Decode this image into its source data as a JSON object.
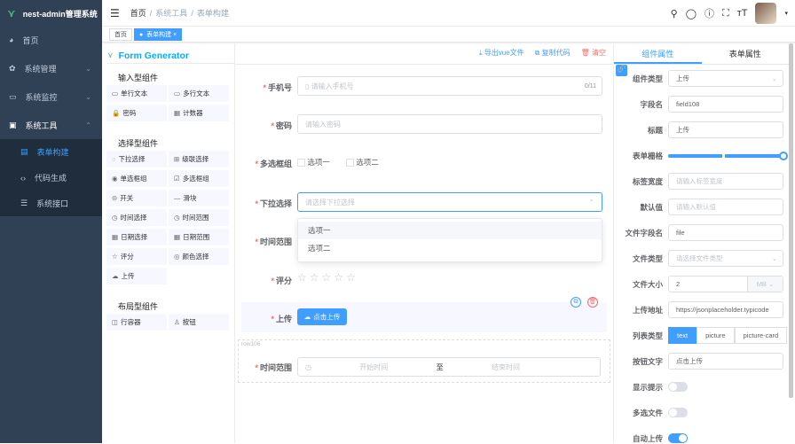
{
  "app": {
    "title": "nest-admin管理系统"
  },
  "sidebar": {
    "items": [
      {
        "label": "首页"
      },
      {
        "label": "系统管理"
      },
      {
        "label": "系统监控"
      },
      {
        "label": "系统工具"
      }
    ],
    "sub": [
      {
        "label": "表单构建"
      },
      {
        "label": "代码生成"
      },
      {
        "label": "系统接口"
      }
    ]
  },
  "breadcrumb": [
    "首页",
    "系统工具",
    "表单构建"
  ],
  "tags": [
    {
      "label": "首页"
    },
    {
      "label": "表单构建"
    }
  ],
  "generator": {
    "title": "Form Generator",
    "export": "导出vue文件",
    "copy": "复制代码",
    "clear": "清空"
  },
  "palette": {
    "cats": [
      {
        "title": "输入型组件",
        "items": [
          "单行文本",
          "多行文本",
          "密码",
          "计数器"
        ]
      },
      {
        "title": "选择型组件",
        "items": [
          "下拉选择",
          "级联选择",
          "单选框组",
          "多选框组",
          "开关",
          "滑块",
          "时间选择",
          "时间范围",
          "日期选择",
          "日期范围",
          "评分",
          "颜色选择",
          "上传"
        ]
      },
      {
        "title": "布局型组件",
        "items": [
          "行容器",
          "按钮"
        ]
      }
    ]
  },
  "form": {
    "phone": {
      "label": "手机号",
      "placeholder": "请输入手机号",
      "count": "0/11"
    },
    "password": {
      "label": "密码",
      "placeholder": "请输入密码"
    },
    "checkbox": {
      "label": "多选框组",
      "options": [
        "选项一",
        "选项二"
      ]
    },
    "select": {
      "label": "下拉选择",
      "placeholder": "请选择下拉选择",
      "options": [
        "选项一",
        "选项二"
      ]
    },
    "timerange": {
      "label": "时间范围"
    },
    "rate": {
      "label": "评分",
      "max": 5,
      "value": 0
    },
    "upload": {
      "label": "上传",
      "button": "点击上传"
    },
    "row": {
      "name": "row106",
      "label": "时间范围",
      "start": "开始时间",
      "sep": "至",
      "end": "结束时间"
    }
  },
  "props": {
    "tabs": [
      "组件属性",
      "表单属性"
    ],
    "type": {
      "label": "组件类型",
      "value": "上传"
    },
    "field": {
      "label": "字段名",
      "value": "field108"
    },
    "title": {
      "label": "标题",
      "value": "上传"
    },
    "span": {
      "label": "表单栅格",
      "value": 24,
      "max": 24
    },
    "labelWidth": {
      "label": "标签宽度",
      "placeholder": "请输入标签宽度"
    },
    "default": {
      "label": "默认值",
      "placeholder": "请输入默认值"
    },
    "fileField": {
      "label": "文件字段名",
      "value": "file"
    },
    "fileType": {
      "label": "文件类型",
      "placeholder": "请选择文件类型"
    },
    "fileSize": {
      "label": "文件大小",
      "value": "2",
      "unit": "MB"
    },
    "action": {
      "label": "上传地址",
      "value": "https://jsonplaceholder.typicode"
    },
    "listType": {
      "label": "列表类型",
      "options": [
        "text",
        "picture",
        "picture-card"
      ],
      "selected": "text"
    },
    "buttonText": {
      "label": "按钮文字",
      "value": "点击上传"
    },
    "showTip": {
      "label": "显示提示",
      "on": false
    },
    "multiple": {
      "label": "多选文件",
      "on": false
    },
    "autoUpload": {
      "label": "自动上传",
      "on": true
    }
  },
  "colors": {
    "primary": "#409eff",
    "sidebar": "#304156",
    "danger": "#f56c6c"
  }
}
